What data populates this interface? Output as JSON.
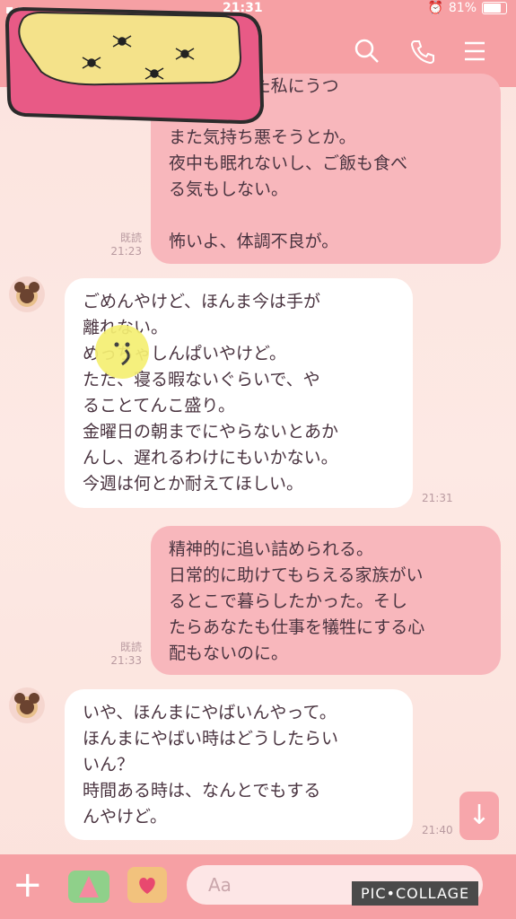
{
  "status": {
    "time": "21:31",
    "battery": "81%"
  },
  "header": {
    "search_icon": "search-icon",
    "call_icon": "phone-icon",
    "menu_icon": "menu-icon"
  },
  "messages": [
    {
      "side": "right",
      "lines": [
        "はのか、また私にうつ",
        "また気持ち悪そうとか。",
        "夜中も眠れないし、ご飯も食べ",
        "る気もしない。",
        "",
        "怖いよ、体調不良が。"
      ],
      "read": "既読",
      "time": "21:23"
    },
    {
      "side": "left",
      "lines": [
        "ごめんやけど、ほんま今は手が",
        "離れない。",
        "めっちゃしんぱいやけど。",
        "たた、寝る暇ないぐらいで、や",
        "ることてんこ盛り。",
        "金曜日の朝までにやらないとあか",
        "んし、遅れるわけにもいかない。",
        "今週は何とか耐えてほしい。"
      ],
      "time": "21:31"
    },
    {
      "side": "right",
      "lines": [
        "精神的に追い詰められる。",
        "日常的に助けてもらえる家族がい",
        "るとこで暮らしたかった。そし",
        "たらあなたも仕事を犠牲にする心",
        "配もないのに。"
      ],
      "read": "既読",
      "time": "21:33"
    },
    {
      "side": "left",
      "lines": [
        "いや、ほんまにやばいんやって。",
        "ほんまにやばい時はどうしたらい",
        "いん？",
        "時間ある時は、なんとでもする",
        "んやけど。"
      ],
      "time": "21:40"
    }
  ],
  "input": {
    "placeholder": "Aa"
  },
  "watermark": "PIC•COLLAGE"
}
